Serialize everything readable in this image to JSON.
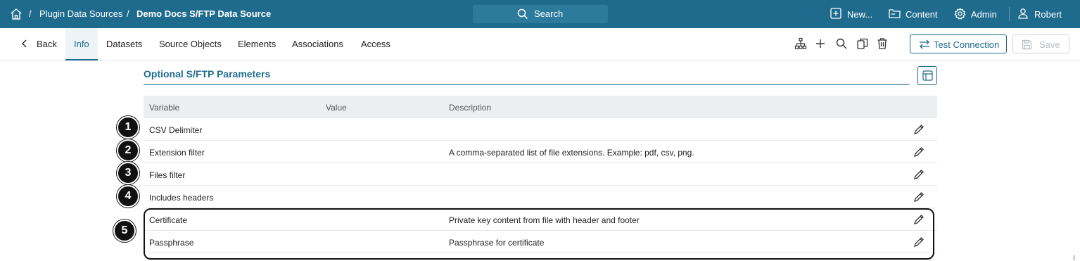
{
  "topbar": {
    "breadcrumbs": [
      "Plugin Data Sources",
      "Demo Docs S/FTP Data Source"
    ],
    "search_label": "Search",
    "new_label": "New...",
    "content_label": "Content",
    "admin_label": "Admin",
    "user_label": "Robert",
    "separator": "/"
  },
  "tabs": {
    "back_label": "Back",
    "items": [
      "Info",
      "Datasets",
      "Source Objects",
      "Elements",
      "Associations",
      "Access"
    ],
    "active": "Info"
  },
  "toolbar": {
    "test_connection_label": "Test Connection",
    "save_label": "Save",
    "icons": [
      "hierarchy-icon",
      "plus-icon",
      "search-icon",
      "copy-icon",
      "trash-icon"
    ]
  },
  "section": {
    "title": "Optional S/FTP Parameters"
  },
  "table": {
    "columns": [
      "Variable",
      "Value",
      "Description"
    ],
    "rows": [
      {
        "variable": "CSV Delimiter",
        "value": "",
        "description": ""
      },
      {
        "variable": "Extension filter",
        "value": "",
        "description": "A comma-separated list of file extensions. Example: pdf, csv, png."
      },
      {
        "variable": "Files filter",
        "value": "",
        "description": ""
      },
      {
        "variable": "Includes headers",
        "value": "",
        "description": ""
      },
      {
        "variable": "Certificate",
        "value": "",
        "description": "Private key content from file with header and footer"
      },
      {
        "variable": "Passphrase",
        "value": "",
        "description": "Passphrase for certificate"
      }
    ]
  },
  "callouts": [
    "1",
    "2",
    "3",
    "4",
    "5"
  ],
  "colors": {
    "topbar": "#1f6b8e",
    "accent": "#1f6b8e",
    "header_bg": "#eceef0"
  }
}
